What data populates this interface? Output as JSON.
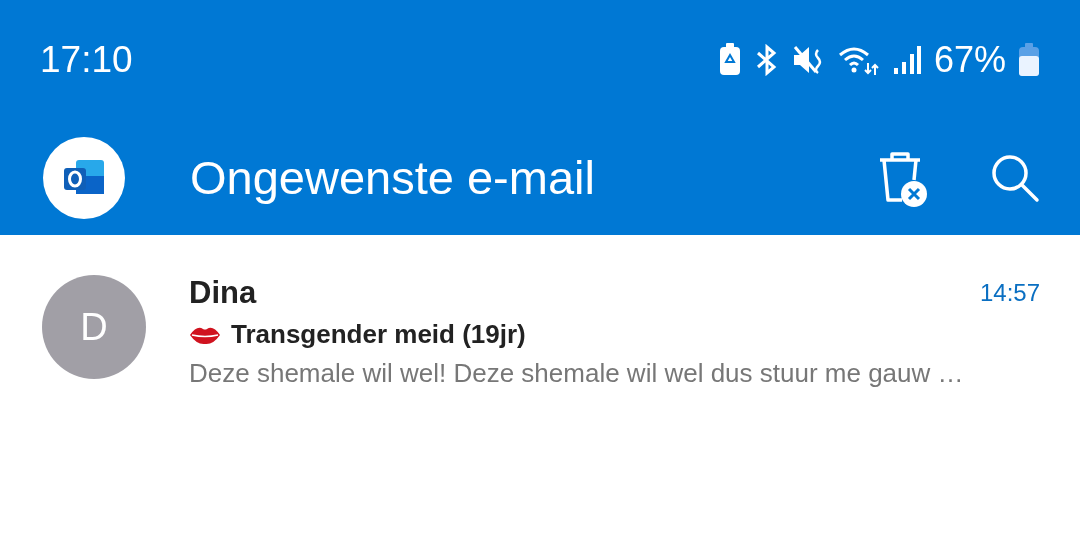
{
  "status_bar": {
    "time": "17:10",
    "battery": "67%"
  },
  "header": {
    "title": "Ongewenste e-mail"
  },
  "messages": [
    {
      "avatar": "D",
      "sender": "Dina",
      "time": "14:57",
      "subject": "Transgender meid (19jr)",
      "preview": "Deze shemale wil wel! Deze shemale wil wel dus stuur me gauw …",
      "unread": true
    }
  ]
}
